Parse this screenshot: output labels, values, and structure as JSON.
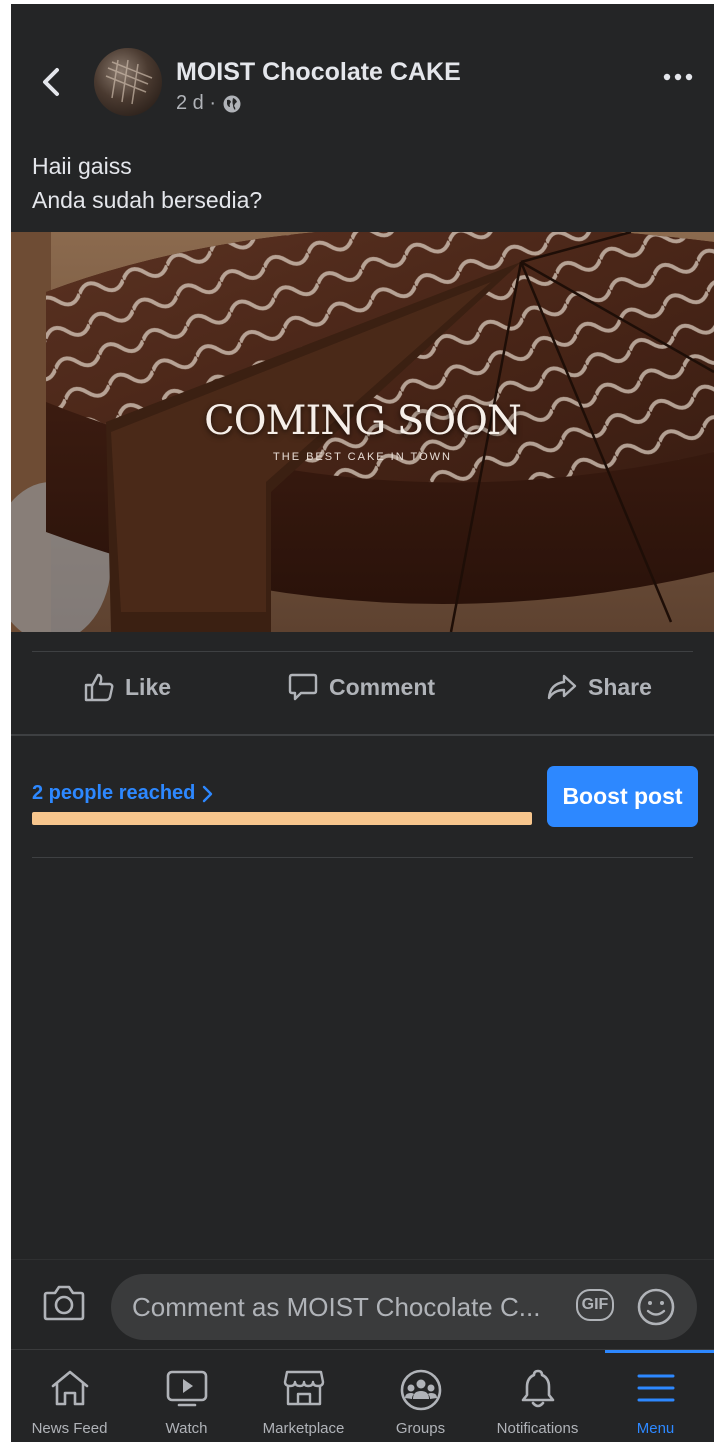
{
  "post": {
    "page_name": "MOIST Chocolate CAKE",
    "time": "2 d ·",
    "text_line1": "Haii gaiss",
    "text_line2": "Anda sudah bersedia?",
    "image_title": "COMING SOON",
    "image_subtitle": "THE BEST CAKE IN TOWN"
  },
  "actions": {
    "like": "Like",
    "comment": "Comment",
    "share": "Share"
  },
  "insights": {
    "reached": "2 people reached",
    "reach_progress": 1.0,
    "boost": "Boost post"
  },
  "comment_box": {
    "placeholder": "Comment as MOIST Chocolate C...",
    "gif": "GIF"
  },
  "tabs": [
    {
      "label": "News Feed",
      "icon": "home-icon"
    },
    {
      "label": "Watch",
      "icon": "watch-icon"
    },
    {
      "label": "Marketplace",
      "icon": "marketplace-icon"
    },
    {
      "label": "Groups",
      "icon": "groups-icon"
    },
    {
      "label": "Notifications",
      "icon": "bell-icon"
    },
    {
      "label": "Menu",
      "icon": "menu-icon",
      "active": true
    }
  ],
  "colors": {
    "background": "#242526",
    "accent": "#2d88ff",
    "progress": "#f7c68d"
  }
}
